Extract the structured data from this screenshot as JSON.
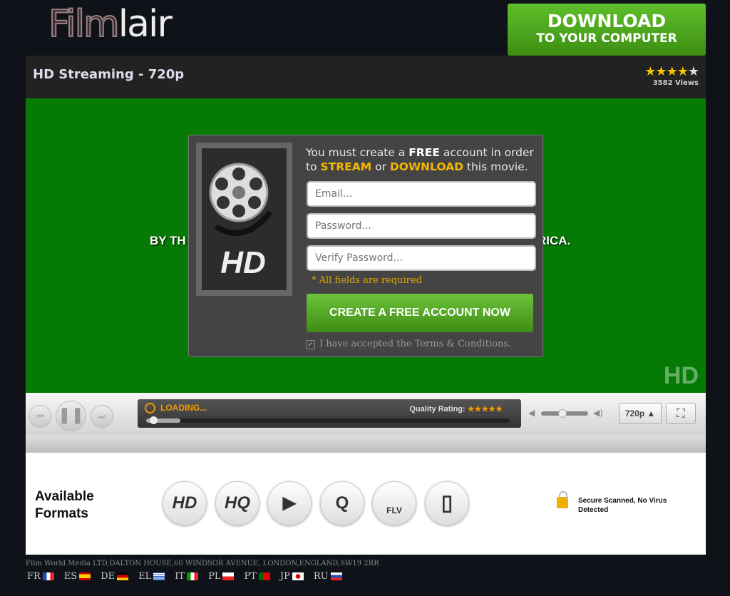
{
  "header": {
    "logo_part1": "Film",
    "logo_part2": "lair",
    "download_line1": "DOWNLOAD",
    "download_line2": "TO YOUR COMPUTER"
  },
  "titlebar": {
    "title": "HD Streaming - 720p",
    "stars": "★★★★★",
    "rating": 4,
    "views": "3582 Views"
  },
  "video": {
    "subtitle_left": "BY TH",
    "subtitle_right": "RICA.",
    "watermark": "HD"
  },
  "modal": {
    "msg_pre": "You must create a ",
    "msg_free": "FREE",
    "msg_mid": " account in order to ",
    "msg_stream": "STREAM",
    "msg_or": " or ",
    "msg_download": "DOWNLOAD",
    "msg_end": " this movie.",
    "email_placeholder": "Email...",
    "password_placeholder": "Password...",
    "verify_placeholder": "Verify Password...",
    "required": "* All fields are required",
    "create_button": "CREATE A FREE ACCOUNT NOW",
    "terms": "I have accepted the Terms & Conditions.",
    "poster_label": "HD"
  },
  "player": {
    "loading": "LOADING...",
    "quality_label": "Quality Rating:",
    "quality_stars": "★★★★★",
    "quality": "720p ▲",
    "progress_percent": 1,
    "volume_percent": 45
  },
  "formats": {
    "title_line1": "Available",
    "title_line2": "Formats",
    "items": [
      "HD",
      "HQ",
      "▶",
      "Q",
      "FLV",
      "▯"
    ],
    "secure": "Secure Scanned, No Virus Detected"
  },
  "footer": {
    "address": "Film World Media LTD,DALTON HOUSE,60 WINDSOR AVENUE, LONDON,ENGLAND,SW19 2RR",
    "languages": [
      "FR",
      "ES",
      "DE",
      "EL",
      "IT",
      "PL",
      "PT",
      "JP",
      "RU"
    ]
  }
}
